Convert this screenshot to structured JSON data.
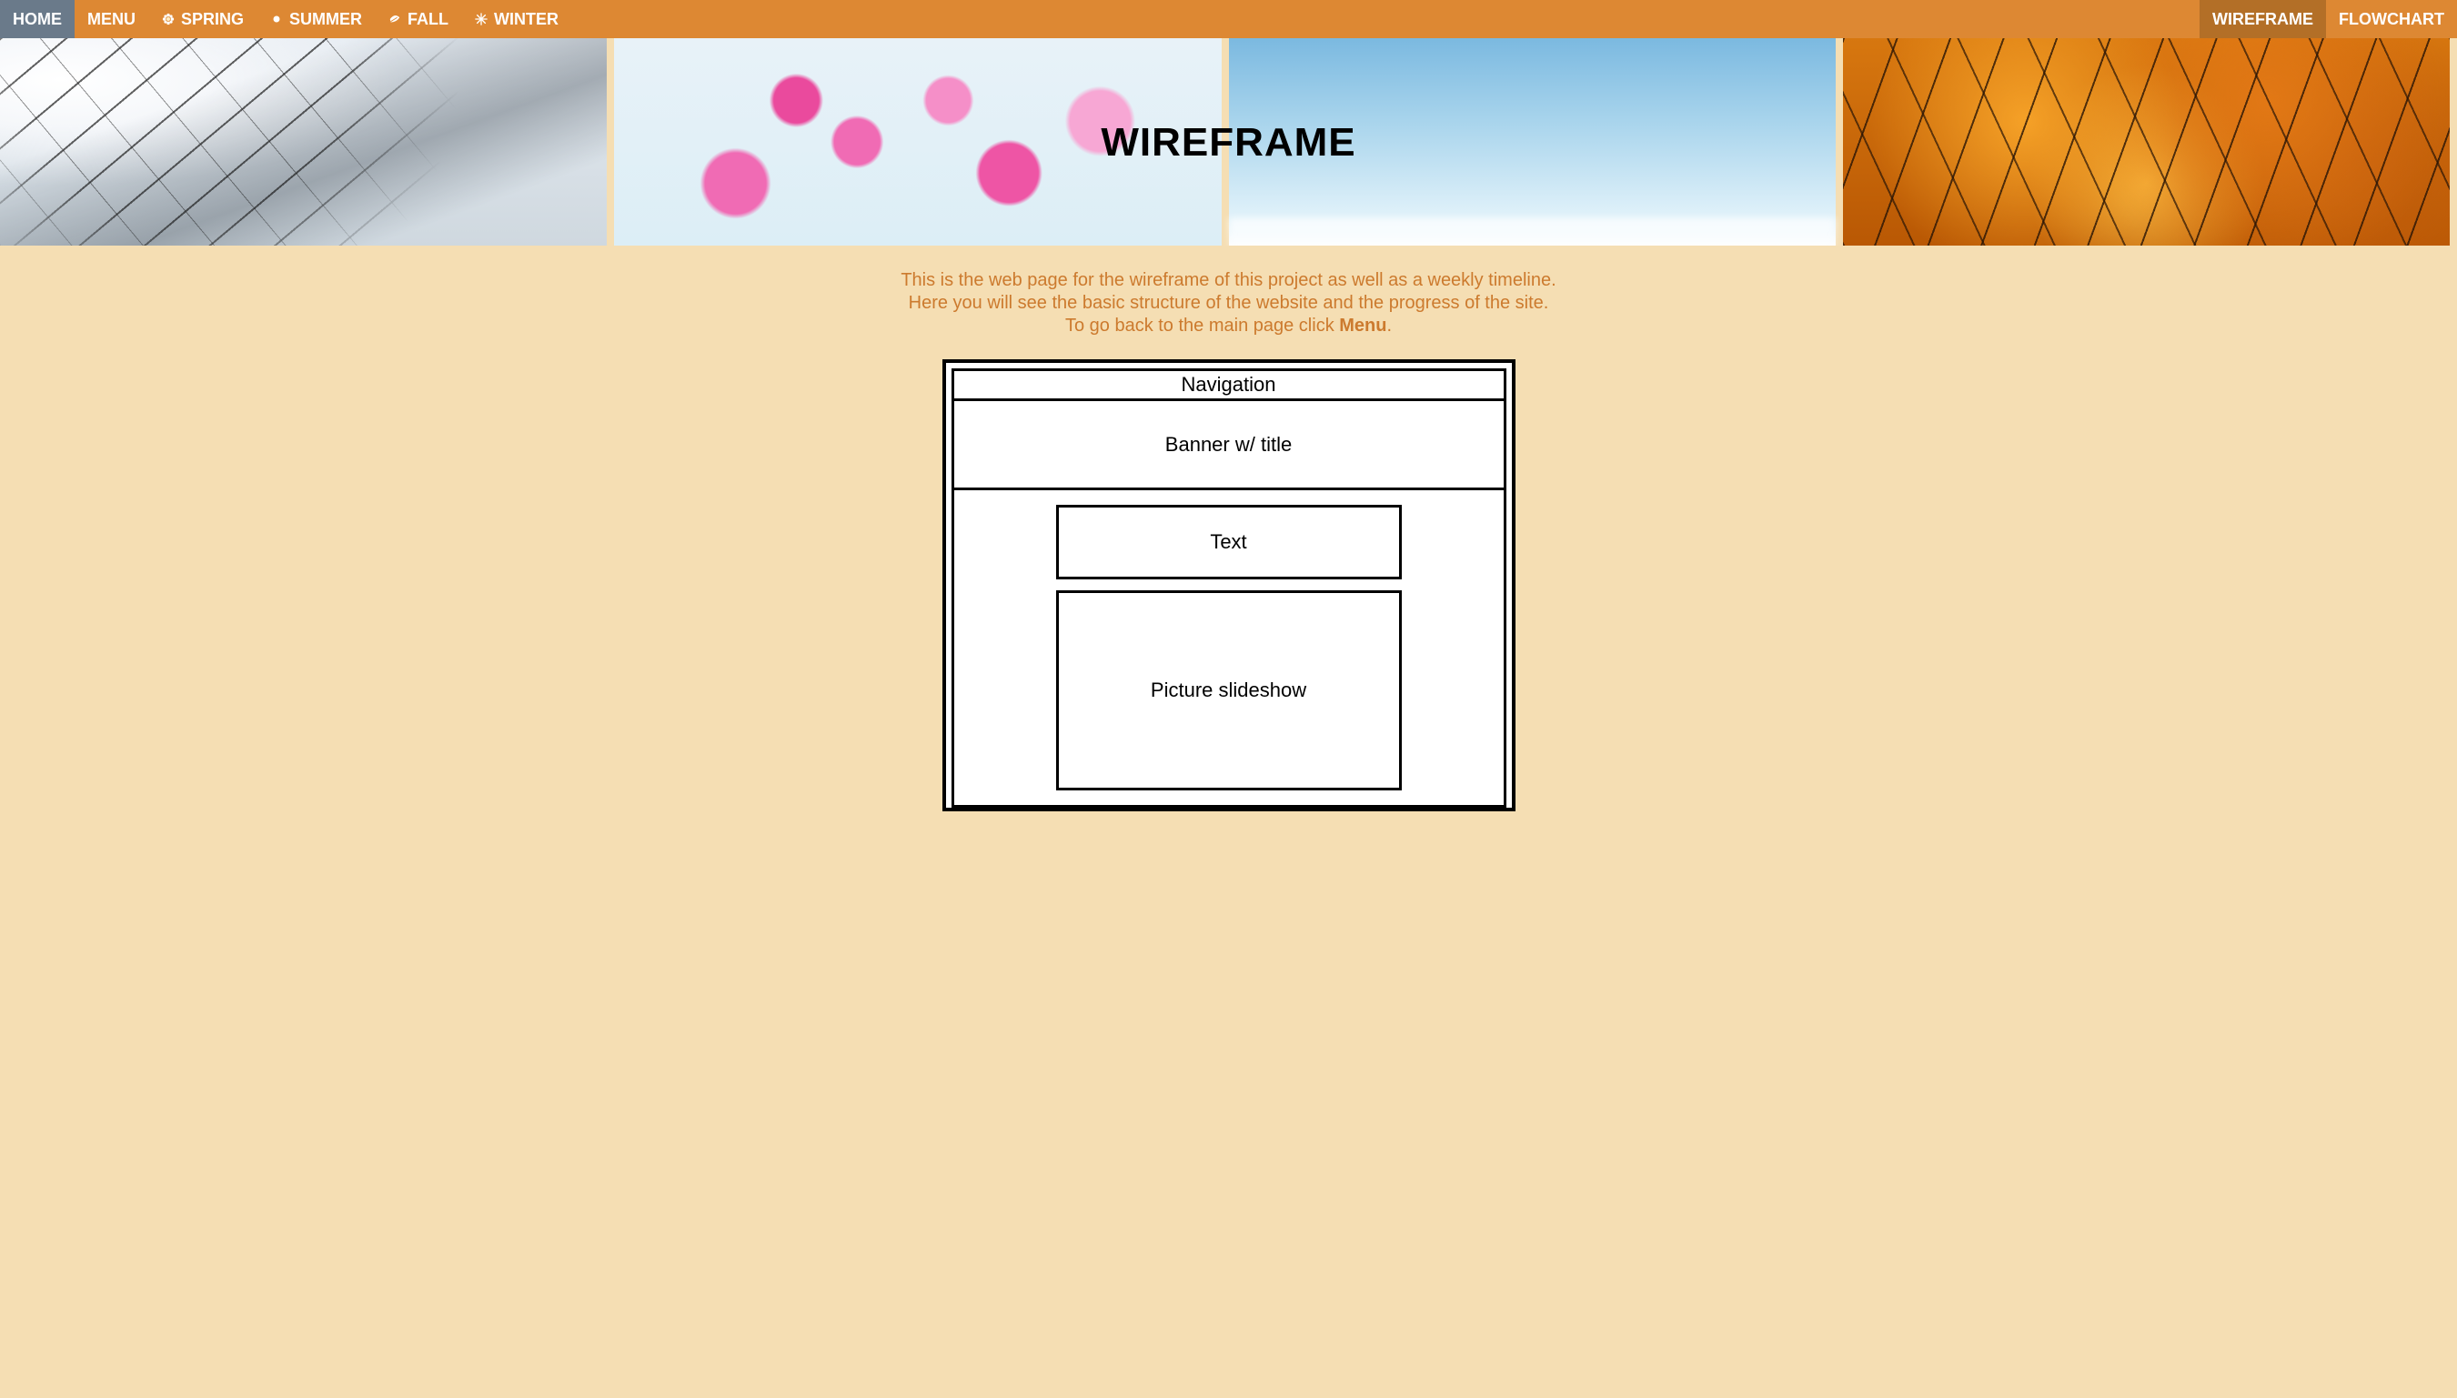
{
  "nav": {
    "left": [
      {
        "label": "HOME",
        "active": true
      },
      {
        "label": "MENU",
        "active": false
      },
      {
        "label": "SPRING",
        "active": false,
        "icon": "flower"
      },
      {
        "label": "SUMMER",
        "active": false,
        "icon": "sun"
      },
      {
        "label": "FALL",
        "active": false,
        "icon": "leaf"
      },
      {
        "label": "WINTER",
        "active": false,
        "icon": "snow"
      }
    ],
    "right": [
      {
        "label": "WIREFRAME",
        "active": true
      },
      {
        "label": "FLOWCHART",
        "active": false
      }
    ]
  },
  "banner": {
    "title": "WIREFRAME",
    "images": [
      "winter",
      "spring",
      "summer",
      "fall"
    ]
  },
  "intro": {
    "line1": "This is the web page for the wireframe of this project as well as a weekly timeline.",
    "line2": "Here you will see the basic structure of the website and the progress of the site.",
    "line3_pre": "To go back to the main page click ",
    "line3_bold": "Menu",
    "line3_post": "."
  },
  "wireframe": {
    "nav": "Navigation",
    "banner": "Banner w/ title",
    "text": "Text",
    "slides": "Picture slideshow"
  }
}
